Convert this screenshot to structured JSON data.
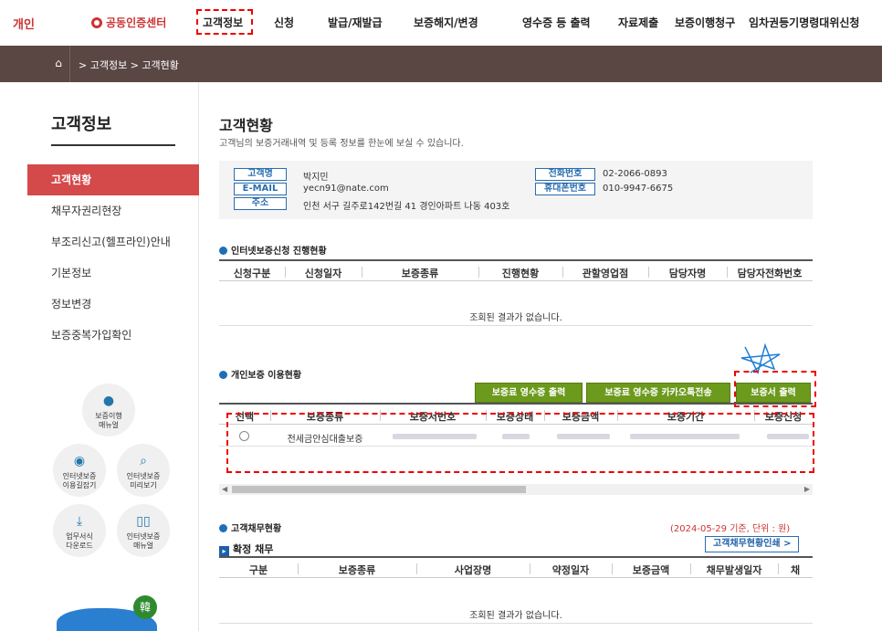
{
  "topnav": {
    "brand": "개인",
    "items": [
      "공동인증센터",
      "고객정보",
      "신청",
      "발급/재발급",
      "보증해지/변경",
      "영수증 등 출력",
      "자료제출",
      "보증이행청구",
      "임차권등기명령대위신청"
    ]
  },
  "breadcrumb": {
    "path": "> 고객정보 > 고객현황"
  },
  "sidebar": {
    "title": "고객정보",
    "items": [
      "고객현황",
      "채무자권리현장",
      "부조리신고(헬프라인)안내",
      "기본정보",
      "정보변경",
      "보증중복가입확인"
    ],
    "quick": [
      {
        "label1": "보증이행",
        "label2": "매뉴얼",
        "icon": "lightbulb-icon"
      },
      {
        "label1": "인터넷보증",
        "label2": "이용길잡기",
        "icon": "location-pin-icon"
      },
      {
        "label1": "인터넷보증",
        "label2": "미리보기",
        "icon": "search-icon"
      },
      {
        "label1": "업무서식",
        "label2": "다운로드",
        "icon": "download-icon"
      },
      {
        "label1": "인터넷보증",
        "label2": "매뉴얼",
        "icon": "book-icon"
      }
    ],
    "banner_seal": "韓"
  },
  "main": {
    "title": "고객현황",
    "subtitle": "고객님의 보증거래내역 및 등록 정보를 한눈에 보실 수 있습니다.",
    "customer": {
      "name_label": "고객명",
      "name": "박지민",
      "email_label": "E-MAIL",
      "email": "yecn91@nate.com",
      "addr_label": "주소",
      "addr": "인천 서구 길주로142번길 41 경인아파트 나동 403호",
      "phone_label": "전화번호",
      "phone": "02-2066-0893",
      "mobile_label": "휴대폰번호",
      "mobile": "010-9947-6675"
    },
    "apply": {
      "title": "인터넷보증신청 진행현황",
      "cols": [
        "신청구분",
        "신청일자",
        "보증종류",
        "진행현황",
        "관할영업점",
        "담당자명",
        "담당자전화번호"
      ],
      "empty": "조회된 결과가 없습니다."
    },
    "personal": {
      "title": "개인보증 이용현황",
      "btn_receipt": "보증료 영수증 출력",
      "btn_kakao": "보증료 영수증 카카오톡전송",
      "btn_cert": "보증서 출력",
      "cols": [
        "선택",
        "보증종류",
        "보증서번호",
        "보증상태",
        "보증금액",
        "보증기간",
        "보증신청"
      ],
      "row_type": "전세금안심대출보증"
    },
    "debt": {
      "title": "고객채무현황",
      "basis": "(2024-05-29 기준, 단위 : 원)",
      "sub": "확정 채무",
      "print_btn": "고객채무현황인쇄 >",
      "cols": [
        "구분",
        "보증종류",
        "사업장명",
        "약정일자",
        "보증금액",
        "채무발생일자",
        "채"
      ],
      "empty": "조회된 결과가 없습니다."
    }
  }
}
